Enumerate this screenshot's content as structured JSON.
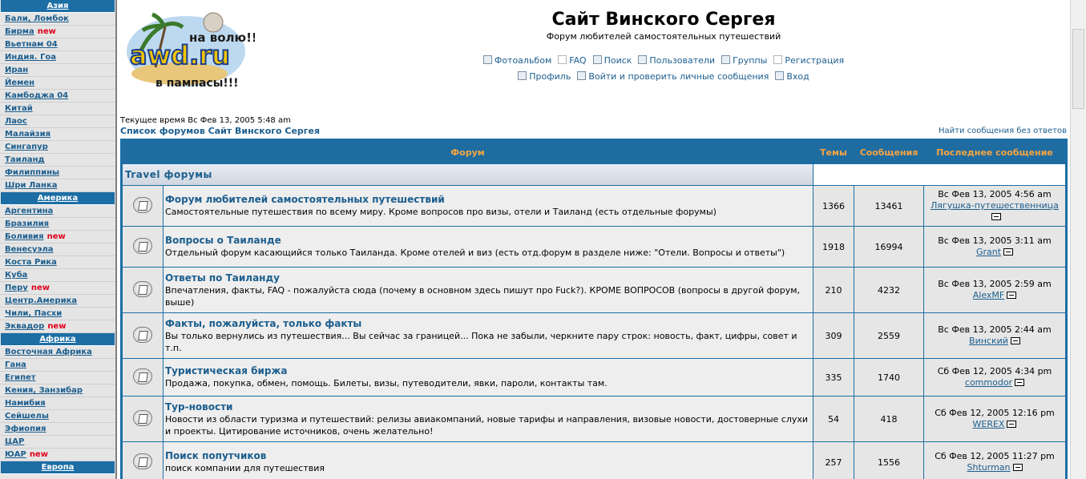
{
  "sidebar": {
    "sections": [
      {
        "title": "Азия",
        "items": [
          {
            "label": "Бали, Ломбок"
          },
          {
            "label": "Бирма",
            "badge": "new"
          },
          {
            "label": "Вьетнам 04"
          },
          {
            "label": "Индия. Гоа"
          },
          {
            "label": "Иран"
          },
          {
            "label": "Йемен"
          },
          {
            "label": "Камбоджа 04"
          },
          {
            "label": "Китай"
          },
          {
            "label": "Лаос"
          },
          {
            "label": "Малайзия"
          },
          {
            "label": "Сингапур"
          },
          {
            "label": "Таиланд"
          },
          {
            "label": "Филиппины"
          },
          {
            "label": "Шри Ланка"
          }
        ]
      },
      {
        "title": "Америка",
        "items": [
          {
            "label": "Аргентина"
          },
          {
            "label": "Бразилия"
          },
          {
            "label": "Боливия",
            "badge": "new"
          },
          {
            "label": "Венесуэла"
          },
          {
            "label": "Коста Рика"
          },
          {
            "label": "Куба"
          },
          {
            "label": "Перу",
            "badge": "new"
          },
          {
            "label": "Центр.Америка"
          },
          {
            "label": "Чили, Пасхи"
          },
          {
            "label": "Эквадор",
            "badge": "new"
          }
        ]
      },
      {
        "title": "Африка",
        "items": [
          {
            "label": "Восточная Африка"
          },
          {
            "label": "Гана"
          },
          {
            "label": "Египет"
          },
          {
            "label": "Кения, Занзибар"
          },
          {
            "label": "Намибия"
          },
          {
            "label": "Сейшелы"
          },
          {
            "label": "Эфиопия"
          },
          {
            "label": "ЦАР"
          },
          {
            "label": "ЮАР",
            "badge": "new"
          }
        ]
      },
      {
        "title": "Европа",
        "items": []
      }
    ]
  },
  "header": {
    "logo_text": "awd.ru",
    "logo_top": "на волю!!!",
    "logo_bottom": "в пампасы!!!",
    "title": "Сайт Винского Сергея",
    "description": "Форум любителей самостоятельных путешествий",
    "nav_row1": [
      {
        "label": "Фотоальбом",
        "icon": "photo-album-icon"
      },
      {
        "label": "FAQ",
        "icon": "faq-icon"
      },
      {
        "label": "Поиск",
        "icon": "search-icon"
      },
      {
        "label": "Пользователи",
        "icon": "members-icon"
      },
      {
        "label": "Группы",
        "icon": "groups-icon"
      },
      {
        "label": "Регистрация",
        "icon": "register-icon"
      }
    ],
    "nav_row2": [
      {
        "label": "Профиль",
        "icon": "profile-icon"
      },
      {
        "label": "Войти и проверить личные сообщения",
        "icon": "messages-icon"
      },
      {
        "label": "Вход",
        "icon": "login-icon"
      }
    ]
  },
  "status": {
    "current_time": "Текущее время Вс Фев 13, 2005 5:48 am",
    "breadcrumb": "Список форумов Сайт Винского Сергея",
    "unanswered": "Найти сообщения без ответов"
  },
  "table": {
    "headers": {
      "forum": "Форум",
      "topics": "Темы",
      "posts": "Сообщения",
      "last": "Последнее сообщение"
    },
    "category": "Travel форумы",
    "forums": [
      {
        "name": "Форум любителей самостоятельных путешествий",
        "desc": "Самостоятельные путешествия по всему миру. Кроме вопросов про визы, отели и Таиланд (есть отдельные форумы)",
        "topics": "1366",
        "posts": "13461",
        "last_date": "Вс Фев 13, 2005 4:56 am",
        "last_user": "Лягушка-путешественница"
      },
      {
        "name": "Вопросы о Таиланде",
        "desc": "Отдельный форум касающийся только Таиланда. Кроме отелей и виз (есть отд.форум в разделе ниже: \"Отели. Вопросы и ответы\")",
        "topics": "1918",
        "posts": "16994",
        "last_date": "Вс Фев 13, 2005 3:11 am",
        "last_user": "Grant"
      },
      {
        "name": "Ответы по Таиланду",
        "desc": "Впечатления, факты, FAQ - пожалуйста сюда (почему в основном здесь пишут про Fuck?). КРОМЕ ВОПРОСОВ (вопросы в другой форум, выше)",
        "topics": "210",
        "posts": "4232",
        "last_date": "Вс Фев 13, 2005 2:59 am",
        "last_user": "AlexMF"
      },
      {
        "name": "Факты, пожалуйста, только факты",
        "desc": "Вы только вернулись из путешествия... Вы сейчас за границей... Пока не забыли, черкните пару строк: новость, факт, цифры, совет и т.п.",
        "topics": "309",
        "posts": "2559",
        "last_date": "Вс Фев 13, 2005 2:44 am",
        "last_user": "Винский"
      },
      {
        "name": "Туристическая биржа",
        "desc": "Продажа, покупка, обмен, помощь. Билеты, визы, путеводители, явки, пароли, контакты там.",
        "topics": "335",
        "posts": "1740",
        "last_date": "Сб Фев 12, 2005 4:34 pm",
        "last_user": "commodor"
      },
      {
        "name": "Тур-новости",
        "desc": "Новости из области туризма и путешествий: релизы авиакомпаний, новые тарифы и направления, визовые новости, достоверные слухи и проекты. Цитирование источников, очень желательно!",
        "topics": "54",
        "posts": "418",
        "last_date": "Сб Фев 12, 2005 12:16 pm",
        "last_user": "WEREX"
      },
      {
        "name": "Поиск попутчиков",
        "desc": "поиск компании для путешествия",
        "topics": "257",
        "posts": "1556",
        "last_date": "Сб Фев 12, 2005 11:27 pm",
        "last_user": "Shturman"
      }
    ]
  }
}
